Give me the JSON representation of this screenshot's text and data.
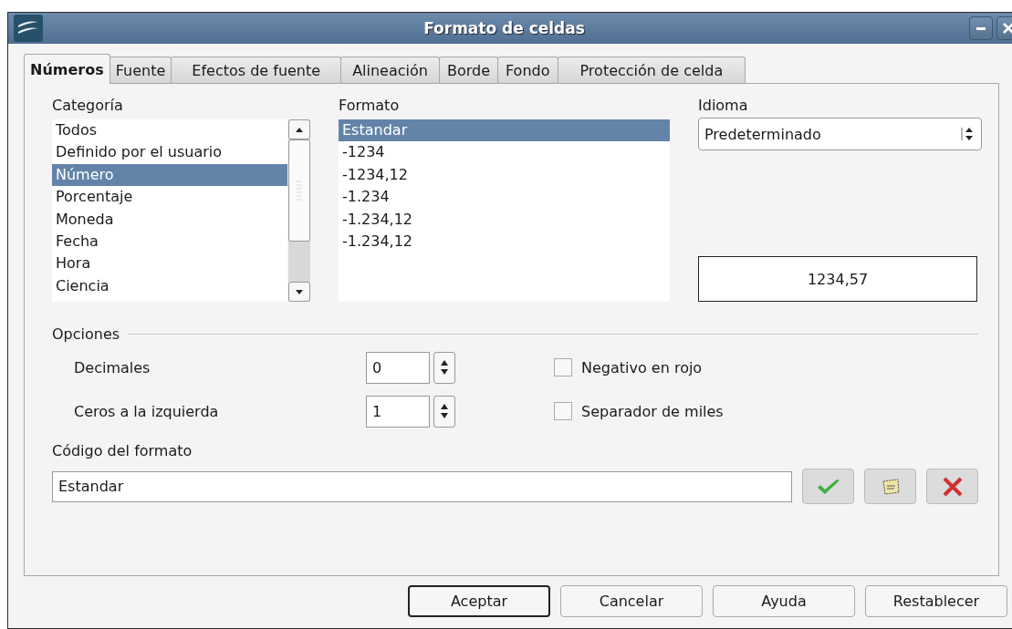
{
  "window": {
    "title": "Formato de celdas"
  },
  "tabs": [
    {
      "label": "Números",
      "selected": true
    },
    {
      "label": "Fuente",
      "selected": false
    },
    {
      "label": "Efectos de fuente",
      "selected": false
    },
    {
      "label": "Alineación",
      "selected": false
    },
    {
      "label": "Borde",
      "selected": false
    },
    {
      "label": "Fondo",
      "selected": false
    },
    {
      "label": "Protección de celda",
      "selected": false
    }
  ],
  "category": {
    "label": "Categoría",
    "items": [
      {
        "label": "Todos",
        "selected": false
      },
      {
        "label": "Definido por el usuario",
        "selected": false
      },
      {
        "label": "Número",
        "selected": true
      },
      {
        "label": "Porcentaje",
        "selected": false
      },
      {
        "label": "Moneda",
        "selected": false
      },
      {
        "label": "Fecha",
        "selected": false
      },
      {
        "label": "Hora",
        "selected": false
      },
      {
        "label": "Ciencia",
        "selected": false
      }
    ]
  },
  "format": {
    "label": "Formato",
    "items": [
      {
        "label": "Estandar",
        "selected": true
      },
      {
        "label": "-1234",
        "selected": false
      },
      {
        "label": "-1234,12",
        "selected": false
      },
      {
        "label": "-1.234",
        "selected": false
      },
      {
        "label": "-1.234,12",
        "selected": false
      },
      {
        "label": "-1.234,12",
        "selected": false
      }
    ]
  },
  "language": {
    "label": "Idioma",
    "value": "Predeterminado"
  },
  "preview": "1234,57",
  "options": {
    "title": "Opciones",
    "spinners": [
      {
        "label": "Decimales",
        "value": "0"
      },
      {
        "label": "Ceros a la izquierda",
        "value": "1"
      }
    ],
    "checkboxes": [
      {
        "label": "Negativo en rojo",
        "checked": false
      },
      {
        "label": "Separador de miles",
        "checked": false
      }
    ]
  },
  "format_code": {
    "label": "Código del formato",
    "value": "Estandar"
  },
  "buttons": [
    {
      "label": "Aceptar",
      "default": true
    },
    {
      "label": "Cancelar",
      "default": false
    },
    {
      "label": "Ayuda",
      "default": false
    },
    {
      "label": "Restablecer",
      "default": false
    }
  ]
}
